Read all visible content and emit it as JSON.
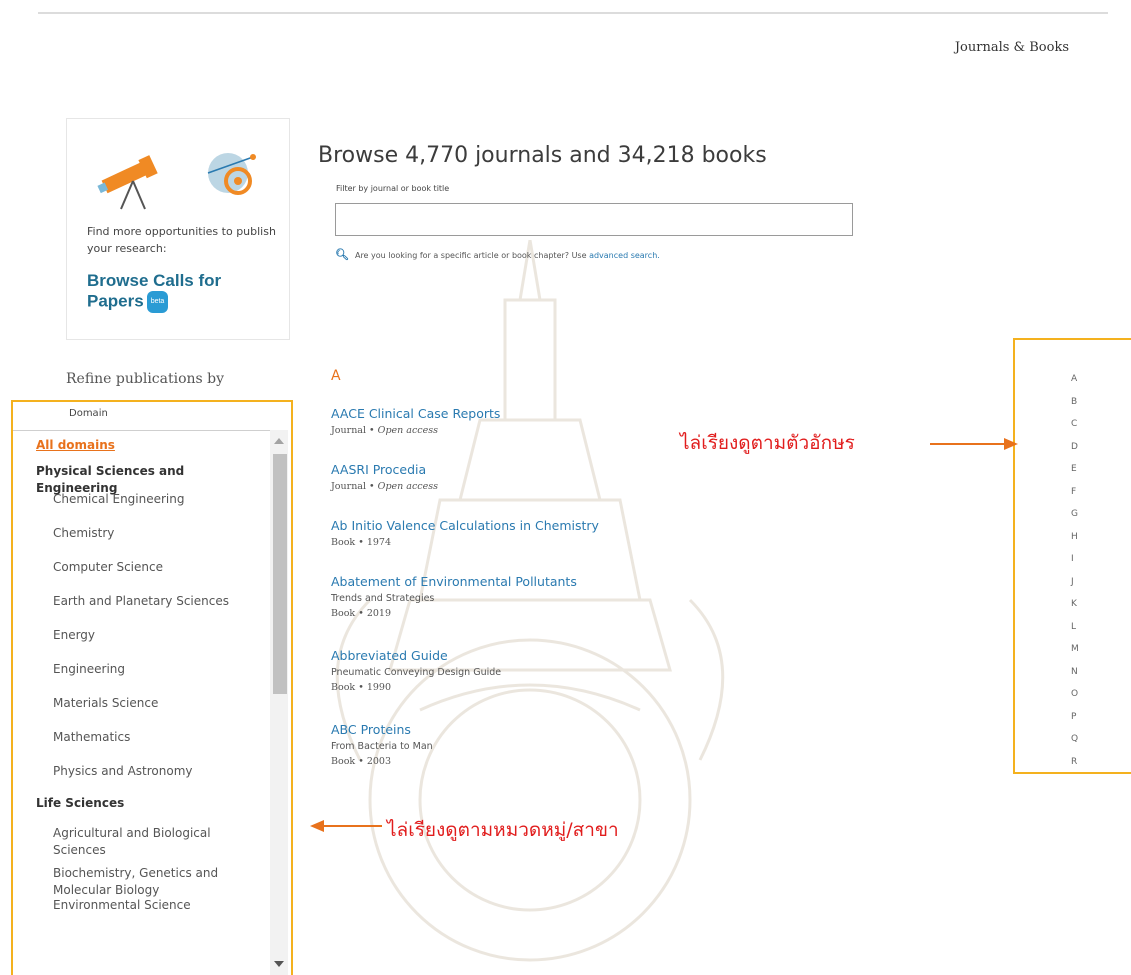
{
  "header": {
    "nav_link": "Journals & Books"
  },
  "promo": {
    "text": "Find more opportunities to publish your research:",
    "link_label": "Browse Calls for Papers",
    "badge": "beta"
  },
  "main": {
    "headline": "Browse 4,770 journals and 34,218 books",
    "filter_label": "Filter by journal or book title",
    "filter_value": "",
    "search_hint_prefix": "Are you looking for a specific article or book chapter? Use",
    "search_hint_link": "advanced search.",
    "current_letter": "A"
  },
  "refine": {
    "title": "Refine publications by",
    "panel_label": "Domain",
    "items": [
      {
        "label": "All domains",
        "kind": "active"
      },
      {
        "label": "Physical Sciences and Engineering",
        "kind": "cat"
      },
      {
        "label": "Chemical Engineering",
        "kind": "sub"
      },
      {
        "label": "Chemistry",
        "kind": "sub"
      },
      {
        "label": "Computer Science",
        "kind": "sub"
      },
      {
        "label": "Earth and Planetary Sciences",
        "kind": "sub"
      },
      {
        "label": "Energy",
        "kind": "sub"
      },
      {
        "label": "Engineering",
        "kind": "sub"
      },
      {
        "label": "Materials Science",
        "kind": "sub"
      },
      {
        "label": "Mathematics",
        "kind": "sub"
      },
      {
        "label": "Physics and Astronomy",
        "kind": "sub"
      },
      {
        "label": "Life Sciences",
        "kind": "cat"
      },
      {
        "label": "Agricultural and Biological Sciences",
        "kind": "sub"
      },
      {
        "label": "Biochemistry, Genetics and Molecular Biology",
        "kind": "sub"
      },
      {
        "label": "Environmental Science",
        "kind": "sub"
      }
    ]
  },
  "results": [
    {
      "title": "AACE Clinical Case Reports",
      "subtitle": "",
      "type": "Journal",
      "detail": "Open access"
    },
    {
      "title": "AASRI Procedia",
      "subtitle": "",
      "type": "Journal",
      "detail": "Open access"
    },
    {
      "title": "Ab Initio Valence Calculations in Chemistry",
      "subtitle": "",
      "type": "Book",
      "detail": "1974"
    },
    {
      "title": "Abatement of Environmental Pollutants",
      "subtitle": "Trends and Strategies",
      "type": "Book",
      "detail": "2019"
    },
    {
      "title": "Abbreviated Guide",
      "subtitle": "Pneumatic Conveying Design Guide",
      "type": "Book",
      "detail": "1990"
    },
    {
      "title": "ABC Proteins",
      "subtitle": "From Bacteria to Man",
      "type": "Book",
      "detail": "2003"
    }
  ],
  "alphabet": [
    "A",
    "B",
    "C",
    "D",
    "E",
    "F",
    "G",
    "H",
    "I",
    "J",
    "K",
    "L",
    "M",
    "N",
    "O",
    "P",
    "Q",
    "R"
  ],
  "annotations": {
    "alphabet_note": "ไล่เรียงดูตามตัวอักษร",
    "domain_note": "ไล่เรียงดูตามหมวดหมู่/สาขา"
  },
  "colors": {
    "accent": "#e8721c",
    "link": "#2a7ab0",
    "highlight_box": "#f4b11e",
    "annotation": "#e11d1d"
  }
}
